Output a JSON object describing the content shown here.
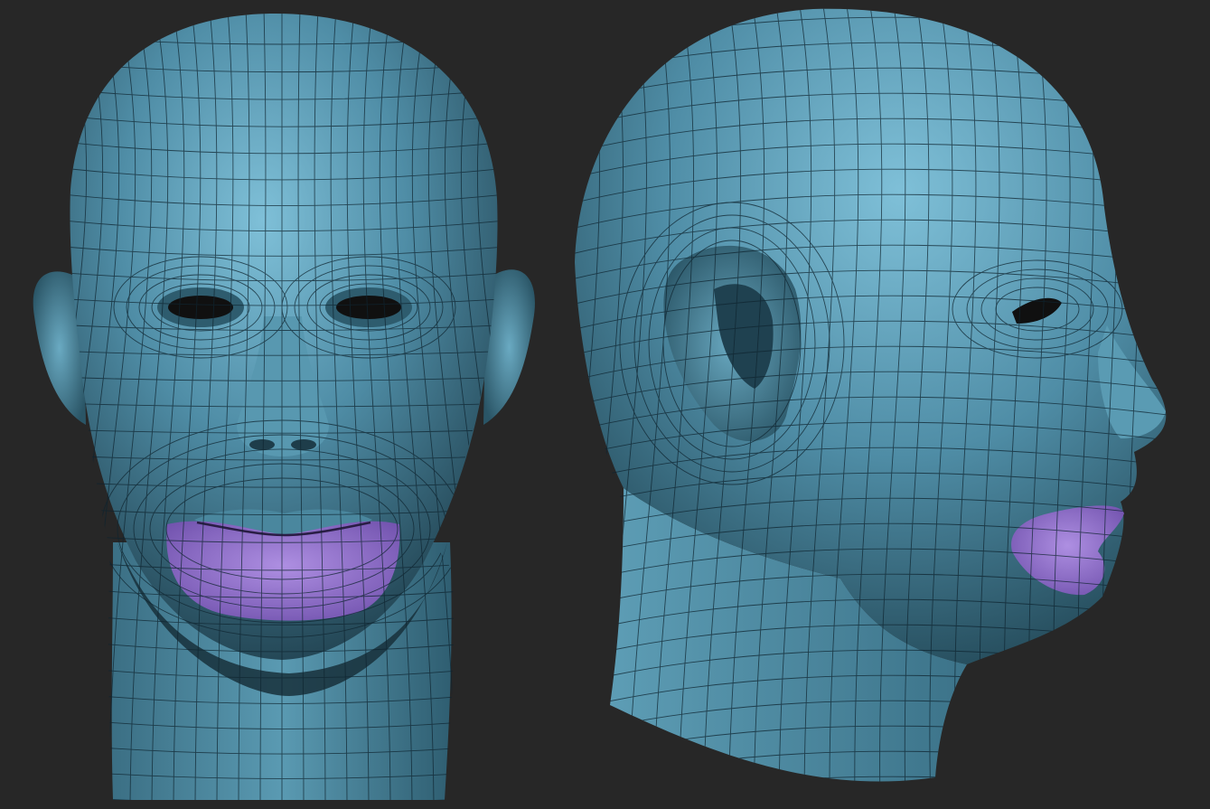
{
  "scene": {
    "background_color": "#272727",
    "skin_color": "#4f8da6",
    "skin_highlight_color": "#7fc0d8",
    "skin_shadow_color": "#1c3a47",
    "wireframe_color": "#0f2530",
    "mask_color": "#8a67c9",
    "mask_highlight_color": "#ae8fe2"
  },
  "views": [
    {
      "view": "front",
      "masked_region": "lower-lip-and-chin"
    },
    {
      "view": "side-right",
      "masked_region": "lower-lip-and-chin"
    }
  ]
}
